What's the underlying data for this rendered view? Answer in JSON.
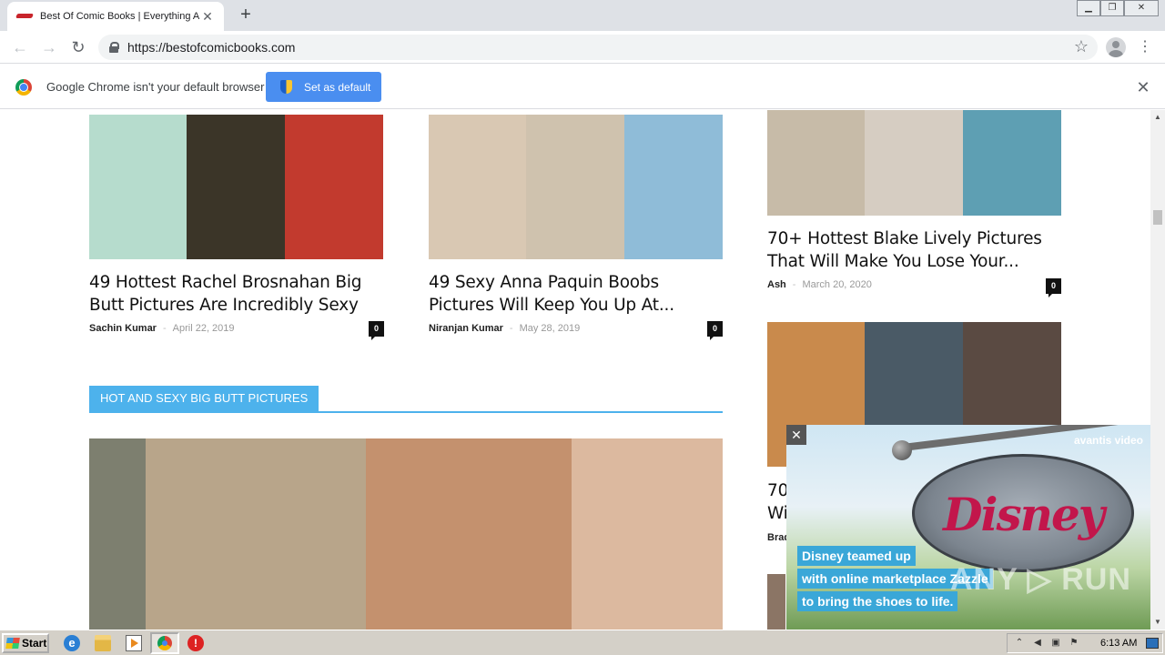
{
  "browser": {
    "tab_title": "Best Of Comic Books | Everything Ab",
    "tab_close": "✕",
    "new_tab": "+",
    "url": "https://bestofcomicbooks.com",
    "window_controls": {
      "minimize": "▁",
      "maximize": "❐",
      "close": "✕"
    }
  },
  "infobar": {
    "message": "Google Chrome isn't your default browser",
    "button_label": "Set as default",
    "close": "✕"
  },
  "articles": [
    {
      "title_line1": "49 Hottest Rachel Brosnahan Big",
      "title_line2": "Butt Pictures Are Incredibly Sexy",
      "author": "Sachin Kumar",
      "date": "April 22, 2019",
      "comments": "0",
      "thumb_colors": [
        "#b6dccd",
        "#3b3528",
        "#c23a2e"
      ]
    },
    {
      "title_line1": "49 Sexy Anna Paquin Boobs",
      "title_line2": "Pictures Will Keep You Up At...",
      "author": "Niranjan Kumar",
      "date": "May 28, 2019",
      "comments": "0",
      "thumb_colors": [
        "#d9c8b3",
        "#cfc2ae",
        "#8fbcd8"
      ]
    },
    {
      "title_line1": "70+ Hottest Blake Lively Pictures",
      "title_line2": "That Will Make You Lose Your...",
      "author": "Ash",
      "date": "March 20, 2020",
      "comments": "0",
      "thumb_colors": [
        "#c7bba8",
        "#d6cdc2",
        "#5e9fb3"
      ]
    },
    {
      "title_line1": "70",
      "title_line2": "Wi",
      "author": "Brad",
      "thumb_colors": [
        "#c98a4c",
        "#4a5a66",
        "#5a4a42"
      ]
    }
  ],
  "section": {
    "title": "HOT AND SEXY BIG BUTT PICTURES",
    "thumb_colors": [
      "#7d7f6f",
      "#b8a58a",
      "#c4916e",
      "#dcb99f"
    ]
  },
  "ad": {
    "brand": "avantis video",
    "sign_text": "Disney",
    "caption_lines": [
      "Disney teamed up",
      "with online marketplace Zazzle",
      "to bring the shoes to life."
    ],
    "close": "✕",
    "watermark": "ANY ▷ RUN"
  },
  "taskbar": {
    "start_label": "Start",
    "time": "6:13 AM"
  },
  "accent_color": "#4db2ec"
}
